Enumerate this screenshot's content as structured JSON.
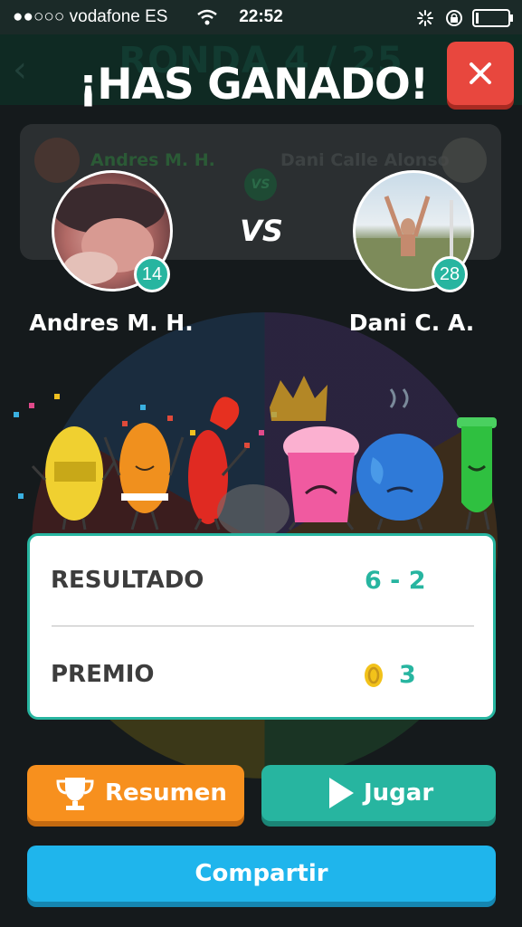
{
  "status_bar": {
    "carrier": "●●○○○ vodafone ES",
    "time": "22:52"
  },
  "background": {
    "round_title": "RONDA 4 / 25",
    "player_left": "Andres M. H.",
    "player_right": "Dani Calle Alonso",
    "vs": "VS"
  },
  "title": "¡HAS GANADO!",
  "close_icon": "close-icon",
  "players": {
    "left": {
      "name": "Andres M. H.",
      "level": "14"
    },
    "right": {
      "name": "Dani C. A.",
      "level": "28"
    },
    "vs": "VS"
  },
  "results": {
    "score_label": "RESULTADO",
    "score_value": "6 - 2",
    "prize_label": "PREMIO",
    "prize_value": "3",
    "coin_icon": "coin-icon"
  },
  "buttons": {
    "resumen": "Resumen",
    "jugar": "Jugar",
    "compartir": "Compartir"
  },
  "colors": {
    "teal": "#27b5a0",
    "orange": "#f7901e",
    "blue": "#1fb5ec",
    "red": "#e8473e"
  }
}
